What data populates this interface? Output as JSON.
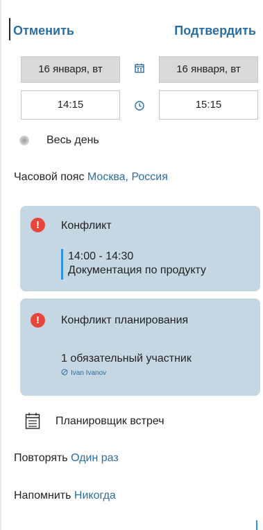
{
  "header": {
    "cancel_label": "Отменить",
    "confirm_label": "Подтвердить"
  },
  "dates": {
    "start_date": "16 января, вт",
    "end_date": "16 января, вт",
    "start_time": "14:15",
    "end_time": "15:15"
  },
  "all_day": {
    "label": "Весь день",
    "checked": false
  },
  "timezone": {
    "label": "Часовой пояс",
    "value": "Москва, Россия"
  },
  "conflict_card": {
    "title": "Конфликт",
    "time_range": "14:00 - 14:30",
    "event_title": "Документация по продукту"
  },
  "scheduling_card": {
    "title": "Конфликт планирования",
    "required_attendees": "1 обязательный участник",
    "attendee_name": "Ivan Ivanov"
  },
  "planner": {
    "label": "Планировщик встреч"
  },
  "repeat": {
    "label": "Повторять",
    "value": "Один раз"
  },
  "reminder": {
    "label": "Напомнить",
    "value": "Никогда"
  },
  "colors": {
    "accent": "#2b6ea2",
    "card_bg": "#c5d7e3",
    "warning": "#e8463b",
    "conflict_bar": "#2b95dc"
  }
}
